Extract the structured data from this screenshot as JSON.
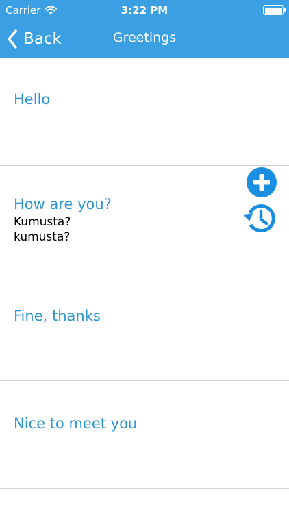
{
  "status_bar": {
    "carrier": "Carrier",
    "time": "3:22 PM"
  },
  "nav": {
    "back_label": "Back",
    "title": "Greetings"
  },
  "phrases": [
    {
      "english": "Hello"
    },
    {
      "english": "How are you?",
      "translation": "Kumusta?",
      "pronunciation": "kumusta?"
    },
    {
      "english": "Fine, thanks"
    },
    {
      "english": "Nice to meet you"
    }
  ],
  "colors": {
    "nav_background": "#3a9fe3",
    "phrase_text": "#2e95d3",
    "action_icon": "#1a8ee0"
  },
  "icons": {
    "add": "plus-circle-icon",
    "history": "history-icon"
  }
}
